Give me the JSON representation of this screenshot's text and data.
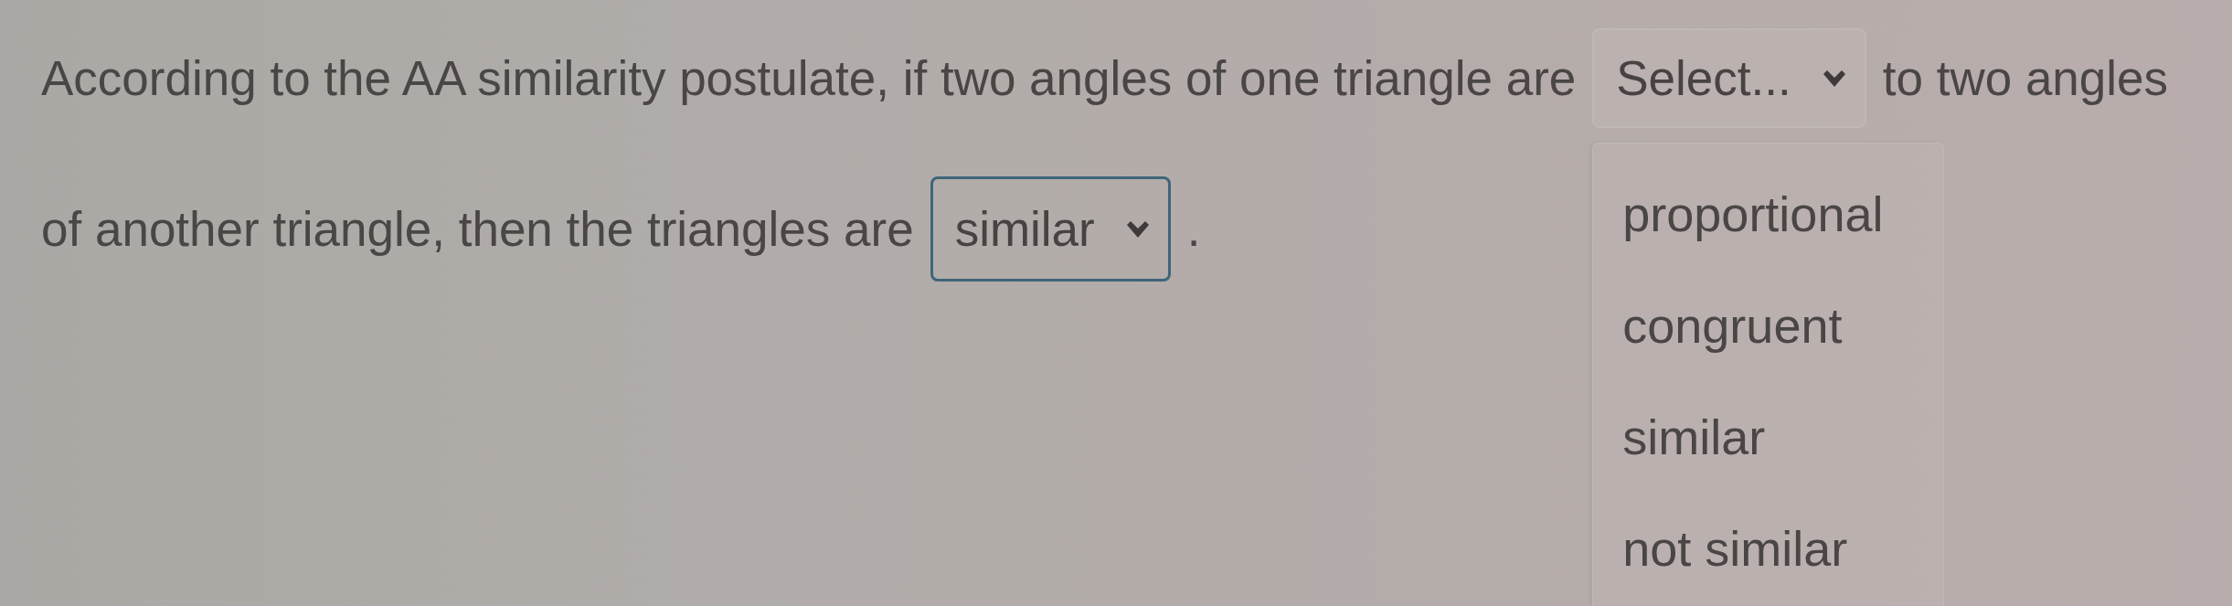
{
  "lines": [
    {
      "parts": [
        {
          "kind": "text",
          "text": "According to the AA similarity postulate, if two angles of one triangle are"
        },
        {
          "kind": "select",
          "placeholder": "Select...",
          "open": true,
          "options": [
            {
              "label": "proportional",
              "selected": false
            },
            {
              "label": "congruent",
              "selected": false
            },
            {
              "label": "similar",
              "selected": false
            },
            {
              "label": "not similar",
              "selected": false
            }
          ]
        },
        {
          "kind": "text",
          "text": "to two angles"
        }
      ]
    },
    {
      "parts": [
        {
          "kind": "text",
          "text": "of another triangle, then the triangles are"
        },
        {
          "kind": "select",
          "value": "similar",
          "open": false
        },
        {
          "kind": "text",
          "text": "."
        }
      ]
    }
  ]
}
